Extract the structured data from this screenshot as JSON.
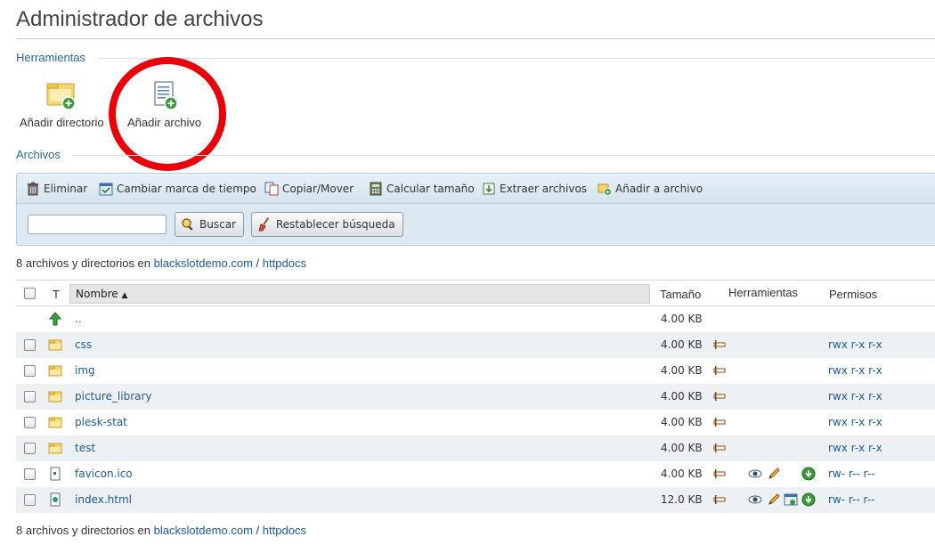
{
  "page": {
    "title": "Administrador de archivos"
  },
  "tools_section": {
    "label": "Herramientas",
    "add_directory": "Añadir directorio",
    "add_file": "Añadir archivo"
  },
  "files_section": {
    "label": "Archivos"
  },
  "actions": {
    "delete": "Eliminar",
    "change_timestamp": "Cambiar marca de tiempo",
    "copy_move": "Copiar/Mover",
    "calc_size": "Calcular tamaño",
    "extract": "Extraer archivos",
    "add_to_archive": "Añadir a archivo"
  },
  "search": {
    "value": "",
    "search_button": "Buscar",
    "reset_button": "Restablecer búsqueda"
  },
  "summary": {
    "prefix": "8 archivos y directorios en",
    "domain": "blackslotdemo.com",
    "separator": "/",
    "folder": "httpdocs"
  },
  "table": {
    "headers": {
      "type": "T",
      "name": "Nombre",
      "sort_indicator": "▲",
      "size": "Tamaño",
      "tools": "Herramientas",
      "permissions": "Permisos"
    },
    "rows": [
      {
        "name": "..",
        "size": "4.00 KB",
        "perms": "",
        "icon": "up-arrow-icon"
      },
      {
        "name": "css",
        "size": "4.00 KB",
        "perms": "rwx r-x r-x",
        "icon": "folder-icon"
      },
      {
        "name": "img",
        "size": "4.00 KB",
        "perms": "rwx r-x r-x",
        "icon": "folder-icon"
      },
      {
        "name": "picture_library",
        "size": "4.00 KB",
        "perms": "rwx r-x r-x",
        "icon": "folder-icon"
      },
      {
        "name": "plesk-stat",
        "size": "4.00 KB",
        "perms": "rwx r-x r-x",
        "icon": "folder-icon"
      },
      {
        "name": "test",
        "size": "4.00 KB",
        "perms": "rwx r-x r-x",
        "icon": "folder-icon"
      },
      {
        "name": "favicon.ico",
        "size": "4.00 KB",
        "perms": "rw- r-- r--",
        "icon": "file-icon"
      },
      {
        "name": "index.html",
        "size": "12.0 KB",
        "perms": "rw- r-- r--",
        "icon": "html-file-icon"
      }
    ]
  },
  "colors": {
    "link": "#1f5a98",
    "section": "#2b6a8f",
    "highlight": "#e8000b",
    "panel": "#dce9f2"
  }
}
